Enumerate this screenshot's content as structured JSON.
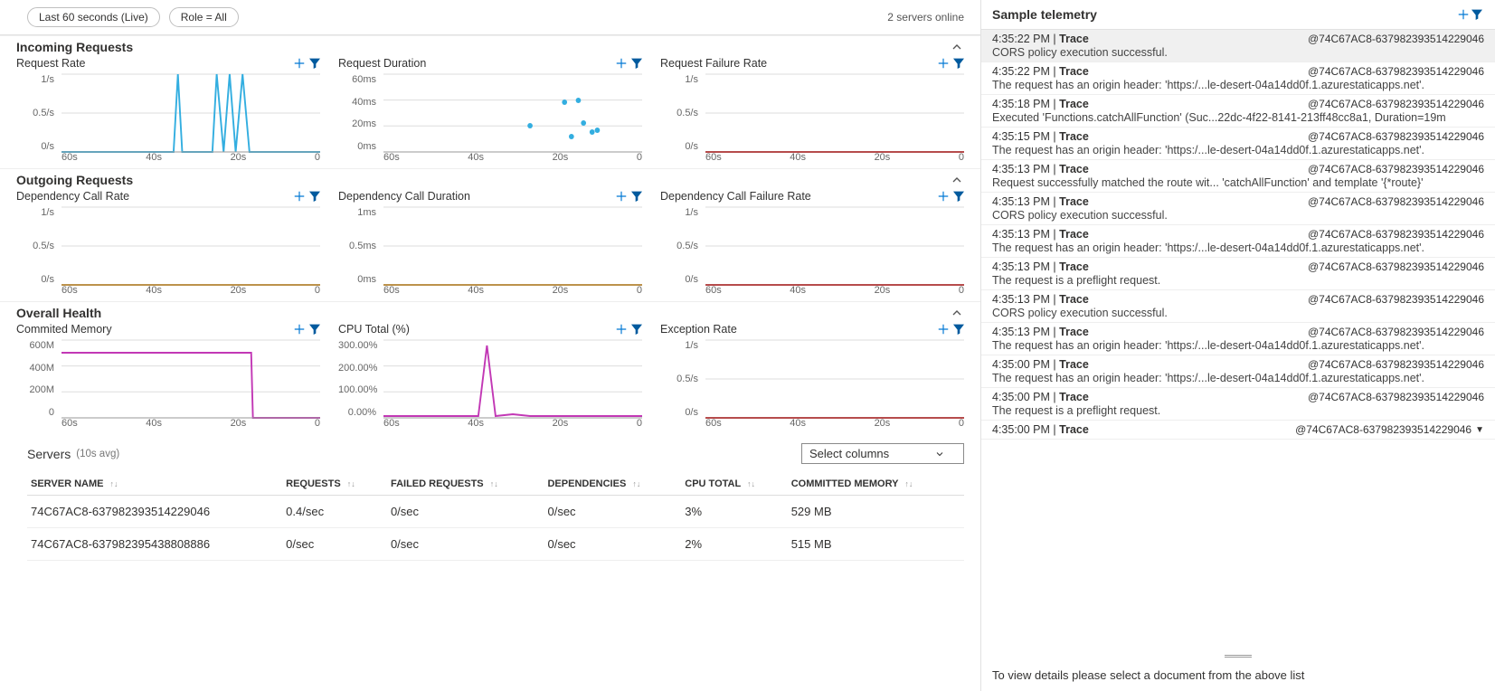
{
  "topbar": {
    "time_pill": "Last 60 seconds (Live)",
    "role_pill": "Role = All",
    "servers_online": "2 servers online"
  },
  "sections": [
    {
      "key": "incoming",
      "title": "Incoming Requests"
    },
    {
      "key": "outgoing",
      "title": "Outgoing Requests"
    },
    {
      "key": "health",
      "title": "Overall Health"
    }
  ],
  "charts": {
    "request_rate": {
      "title": "Request Rate",
      "ylabels": [
        "1/s",
        "0.5/s",
        "0/s"
      ]
    },
    "request_duration": {
      "title": "Request Duration",
      "ylabels": [
        "60ms",
        "40ms",
        "20ms",
        "0ms"
      ]
    },
    "request_failure": {
      "title": "Request Failure Rate",
      "ylabels": [
        "1/s",
        "0.5/s",
        "0/s"
      ]
    },
    "dep_rate": {
      "title": "Dependency Call Rate",
      "ylabels": [
        "1/s",
        "0.5/s",
        "0/s"
      ]
    },
    "dep_duration": {
      "title": "Dependency Call Duration",
      "ylabels": [
        "1ms",
        "0.5ms",
        "0ms"
      ]
    },
    "dep_failure": {
      "title": "Dependency Call Failure Rate",
      "ylabels": [
        "1/s",
        "0.5/s",
        "0/s"
      ]
    },
    "memory": {
      "title": "Commited Memory",
      "ylabels": [
        "600M",
        "400M",
        "200M",
        "0"
      ]
    },
    "cpu": {
      "title": "CPU Total (%)",
      "ylabels": [
        "300.00%",
        "200.00%",
        "100.00%",
        "0.00%"
      ]
    },
    "exception": {
      "title": "Exception Rate",
      "ylabels": [
        "1/s",
        "0.5/s",
        "0/s"
      ]
    }
  },
  "xaxis_labels": [
    "60s",
    "40s",
    "20s",
    "0"
  ],
  "chart_data": [
    {
      "chart": "request_rate",
      "type": "line",
      "x_range": [
        60,
        0
      ],
      "y_range": [
        0,
        1
      ],
      "unit": "requests/s",
      "series": [
        {
          "name": "rate",
          "approx_values": [
            {
              "t": 60,
              "v": 0
            },
            {
              "t": 34,
              "v": 0
            },
            {
              "t": 33,
              "v": 1
            },
            {
              "t": 32,
              "v": 0
            },
            {
              "t": 25,
              "v": 0
            },
            {
              "t": 24,
              "v": 1
            },
            {
              "t": 23,
              "v": 0
            },
            {
              "t": 22,
              "v": 1
            },
            {
              "t": 21,
              "v": 0
            },
            {
              "t": 19,
              "v": 1
            },
            {
              "t": 17,
              "v": 0
            },
            {
              "t": 0,
              "v": 0
            }
          ]
        }
      ]
    },
    {
      "chart": "request_duration",
      "type": "scatter",
      "x_range": [
        60,
        0
      ],
      "y_range": [
        0,
        60
      ],
      "unit": "ms",
      "series": [
        {
          "name": "duration",
          "approx_points": [
            {
              "t": 26,
              "v": 20
            },
            {
              "t": 18,
              "v": 38
            },
            {
              "t": 16,
              "v": 12
            },
            {
              "t": 15,
              "v": 40
            },
            {
              "t": 14,
              "v": 22
            },
            {
              "t": 12,
              "v": 15
            },
            {
              "t": 11,
              "v": 17
            }
          ]
        }
      ]
    },
    {
      "chart": "request_failure",
      "type": "line",
      "x_range": [
        60,
        0
      ],
      "y_range": [
        0,
        1
      ],
      "unit": "failures/s",
      "series": [
        {
          "name": "failures",
          "approx_values": [
            {
              "t": 60,
              "v": 0
            },
            {
              "t": 0,
              "v": 0
            }
          ]
        }
      ]
    },
    {
      "chart": "dep_rate",
      "type": "line",
      "x_range": [
        60,
        0
      ],
      "y_range": [
        0,
        1
      ],
      "unit": "calls/s",
      "series": [
        {
          "name": "rate",
          "approx_values": [
            {
              "t": 60,
              "v": 0
            },
            {
              "t": 0,
              "v": 0
            }
          ]
        }
      ]
    },
    {
      "chart": "dep_duration",
      "type": "line",
      "x_range": [
        60,
        0
      ],
      "y_range": [
        0,
        1
      ],
      "unit": "ms",
      "series": [
        {
          "name": "duration",
          "approx_values": [
            {
              "t": 60,
              "v": 0
            },
            {
              "t": 0,
              "v": 0
            }
          ]
        }
      ]
    },
    {
      "chart": "dep_failure",
      "type": "line",
      "x_range": [
        60,
        0
      ],
      "y_range": [
        0,
        1
      ],
      "unit": "failures/s",
      "series": [
        {
          "name": "failures",
          "approx_values": [
            {
              "t": 60,
              "v": 0
            },
            {
              "t": 0,
              "v": 0
            }
          ]
        }
      ]
    },
    {
      "chart": "memory",
      "type": "line",
      "x_range": [
        60,
        0
      ],
      "y_range": [
        0,
        600
      ],
      "unit": "MB",
      "series": [
        {
          "name": "committed",
          "approx_values": [
            {
              "t": 60,
              "v": 500
            },
            {
              "t": 16,
              "v": 500
            },
            {
              "t": 15,
              "v": 0
            },
            {
              "t": 0,
              "v": 0
            }
          ]
        }
      ]
    },
    {
      "chart": "cpu",
      "type": "line",
      "x_range": [
        60,
        0
      ],
      "y_range": [
        0,
        300
      ],
      "unit": "percent",
      "series": [
        {
          "name": "cpu",
          "approx_values": [
            {
              "t": 60,
              "v": 3
            },
            {
              "t": 38,
              "v": 3
            },
            {
              "t": 36,
              "v": 280
            },
            {
              "t": 34,
              "v": 3
            },
            {
              "t": 0,
              "v": 3
            }
          ]
        }
      ]
    },
    {
      "chart": "exception",
      "type": "line",
      "x_range": [
        60,
        0
      ],
      "y_range": [
        0,
        1
      ],
      "unit": "exceptions/s",
      "series": [
        {
          "name": "exceptions",
          "approx_values": [
            {
              "t": 60,
              "v": 0
            },
            {
              "t": 0,
              "v": 0
            }
          ]
        }
      ]
    }
  ],
  "servers": {
    "title": "Servers",
    "subtitle": "(10s avg)",
    "select_columns_label": "Select columns",
    "headers": [
      "SERVER NAME",
      "REQUESTS",
      "FAILED REQUESTS",
      "DEPENDENCIES",
      "CPU TOTAL",
      "COMMITTED MEMORY"
    ],
    "rows": [
      {
        "name": "74C67AC8-637982393514229046",
        "requests": "0.4/sec",
        "failed": "0/sec",
        "deps": "0/sec",
        "cpu": "3%",
        "mem": "529 MB"
      },
      {
        "name": "74C67AC8-637982395438808886",
        "requests": "0/sec",
        "failed": "0/sec",
        "deps": "0/sec",
        "cpu": "2%",
        "mem": "515 MB"
      }
    ]
  },
  "telemetry": {
    "title": "Sample telemetry",
    "footer": "To view details please select a document from the above list",
    "items": [
      {
        "ts": "4:35:22 PM",
        "type": "Trace",
        "id": "@74C67AC8-637982393514229046",
        "msg": "CORS policy execution successful.",
        "selected": true
      },
      {
        "ts": "4:35:22 PM",
        "type": "Trace",
        "id": "@74C67AC8-637982393514229046",
        "msg": "The request has an origin header: 'https:/...le-desert-04a14dd0f.1.azurestaticapps.net'."
      },
      {
        "ts": "4:35:18 PM",
        "type": "Trace",
        "id": "@74C67AC8-637982393514229046",
        "msg": "Executed 'Functions.catchAllFunction' (Suc...22dc-4f22-8141-213ff48cc8a1, Duration=19m"
      },
      {
        "ts": "4:35:15 PM",
        "type": "Trace",
        "id": "@74C67AC8-637982393514229046",
        "msg": "The request has an origin header: 'https:/...le-desert-04a14dd0f.1.azurestaticapps.net'."
      },
      {
        "ts": "4:35:13 PM",
        "type": "Trace",
        "id": "@74C67AC8-637982393514229046",
        "msg": "Request successfully matched the route wit... 'catchAllFunction' and template '{*route}'"
      },
      {
        "ts": "4:35:13 PM",
        "type": "Trace",
        "id": "@74C67AC8-637982393514229046",
        "msg": "CORS policy execution successful."
      },
      {
        "ts": "4:35:13 PM",
        "type": "Trace",
        "id": "@74C67AC8-637982393514229046",
        "msg": "The request has an origin header: 'https:/...le-desert-04a14dd0f.1.azurestaticapps.net'."
      },
      {
        "ts": "4:35:13 PM",
        "type": "Trace",
        "id": "@74C67AC8-637982393514229046",
        "msg": "The request is a preflight request."
      },
      {
        "ts": "4:35:13 PM",
        "type": "Trace",
        "id": "@74C67AC8-637982393514229046",
        "msg": "CORS policy execution successful."
      },
      {
        "ts": "4:35:13 PM",
        "type": "Trace",
        "id": "@74C67AC8-637982393514229046",
        "msg": "The request has an origin header: 'https:/...le-desert-04a14dd0f.1.azurestaticapps.net'."
      },
      {
        "ts": "4:35:00 PM",
        "type": "Trace",
        "id": "@74C67AC8-637982393514229046",
        "msg": "The request has an origin header: 'https:/...le-desert-04a14dd0f.1.azurestaticapps.net'."
      },
      {
        "ts": "4:35:00 PM",
        "type": "Trace",
        "id": "@74C67AC8-637982393514229046",
        "msg": "The request is a preflight request."
      },
      {
        "ts": "4:35:00 PM",
        "type": "Trace",
        "id": "@74C67AC8-637982393514229046",
        "msg": "",
        "arrow": true
      }
    ]
  }
}
